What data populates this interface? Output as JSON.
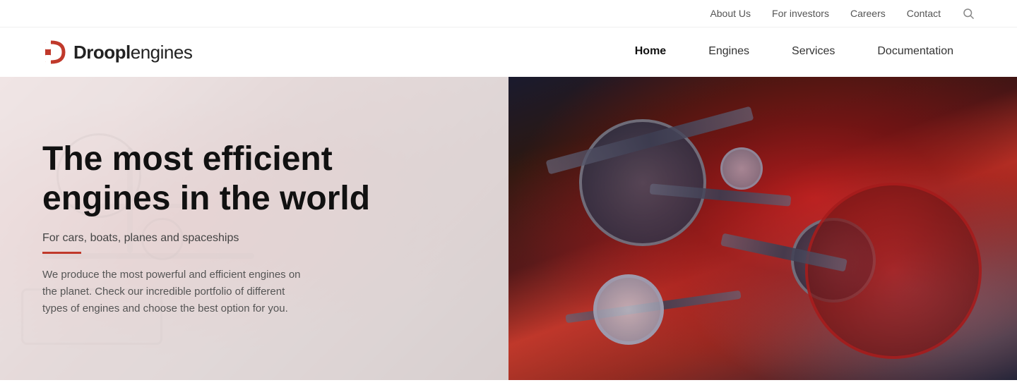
{
  "header": {
    "logo_brand": "Droopl",
    "logo_suffix": "engines",
    "top_nav": [
      {
        "label": "About Us",
        "id": "about-us"
      },
      {
        "label": "For investors",
        "id": "for-investors"
      },
      {
        "label": "Careers",
        "id": "careers"
      },
      {
        "label": "Contact",
        "id": "contact"
      }
    ],
    "main_nav": [
      {
        "label": "Home",
        "id": "home",
        "active": true
      },
      {
        "label": "Engines",
        "id": "engines",
        "active": false
      },
      {
        "label": "Services",
        "id": "services",
        "active": false
      },
      {
        "label": "Documentation",
        "id": "documentation",
        "active": false
      }
    ]
  },
  "hero": {
    "title": "The most efficient engines in the world",
    "subtitle": "For cars, boats, planes and spaceships",
    "description": "We produce the most powerful and efficient engines on the planet. Check our incredible portfolio of different types of engines and choose the best option for you."
  }
}
